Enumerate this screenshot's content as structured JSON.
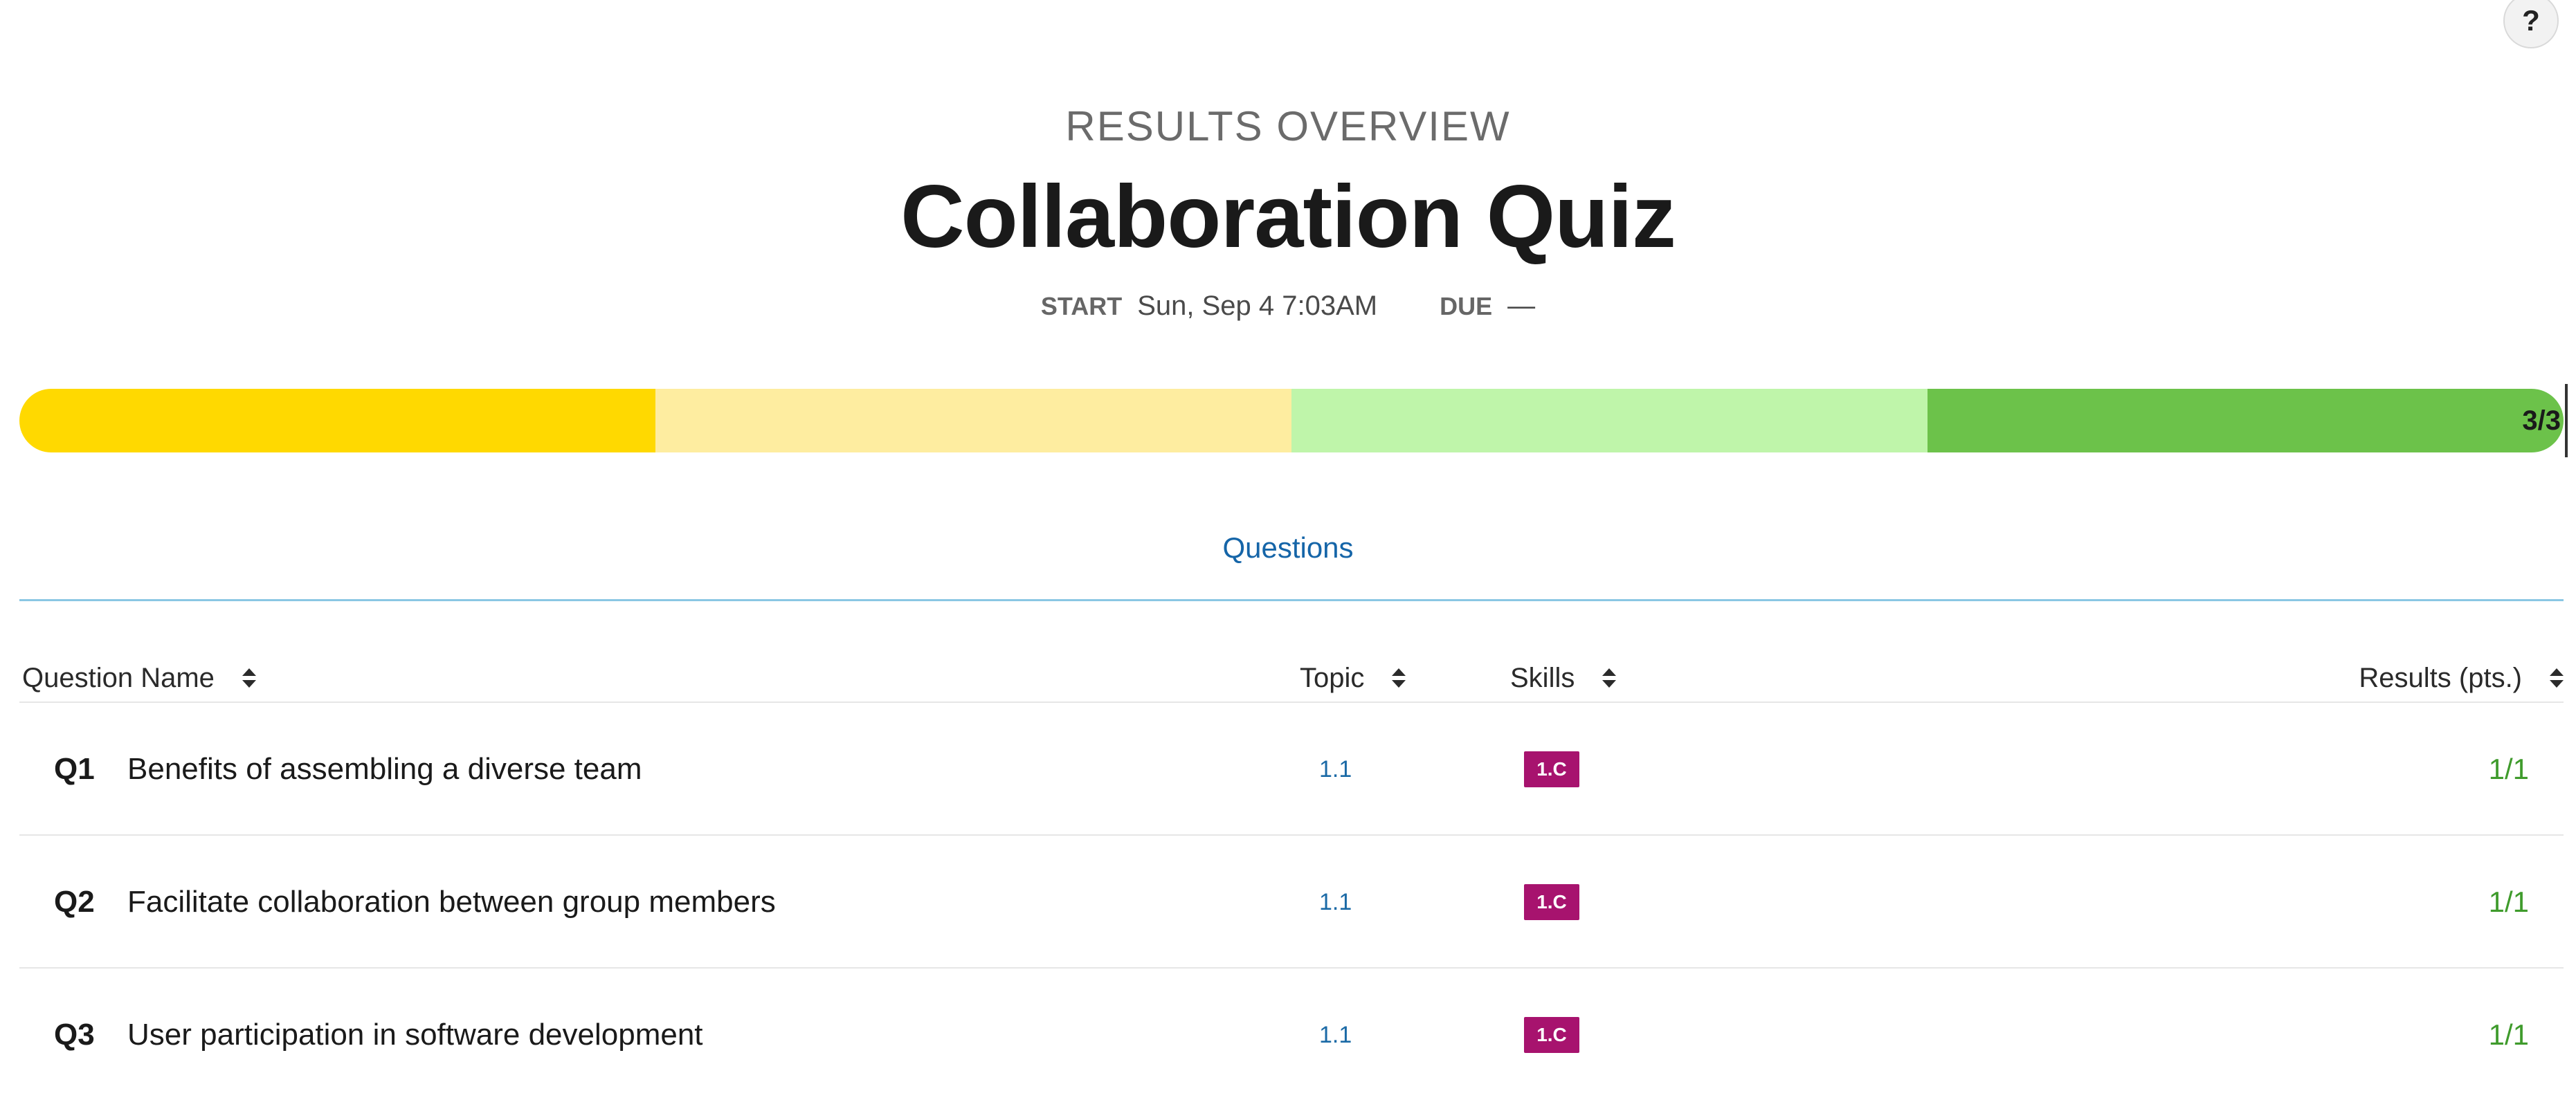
{
  "help": {
    "label": "?"
  },
  "header": {
    "eyebrow": "RESULTS OVERVIEW",
    "title": "Collaboration Quiz",
    "start_label": "START",
    "start_value": "Sun, Sep 4 7:03AM",
    "due_label": "DUE",
    "due_value": "—"
  },
  "progress": {
    "label": "3/3",
    "score": 3,
    "total": 3,
    "segment_colors": [
      "#ffd900",
      "#feeda0",
      "#bff5aa",
      "#6cc24a"
    ]
  },
  "tabs": [
    {
      "label": "Questions",
      "active": true
    }
  ],
  "table": {
    "columns": {
      "question_name": "Question Name",
      "topic": "Topic",
      "skills": "Skills",
      "results": "Results (pts.)"
    },
    "rows": [
      {
        "num": "Q1",
        "name": "Benefits of assembling a diverse team",
        "topic": "1.1",
        "skill": "1.C",
        "result": "1/1"
      },
      {
        "num": "Q2",
        "name": "Facilitate collaboration between group members",
        "topic": "1.1",
        "skill": "1.C",
        "result": "1/1"
      },
      {
        "num": "Q3",
        "name": "User participation in software development",
        "topic": "1.1",
        "skill": "1.C",
        "result": "1/1"
      }
    ]
  },
  "colors": {
    "skill_badge": "#a7136e",
    "result_text": "#3f9b2c",
    "topic_text": "#1b6aa6",
    "tab_text": "#1565a8",
    "tab_underline": "#8ac7e3"
  }
}
